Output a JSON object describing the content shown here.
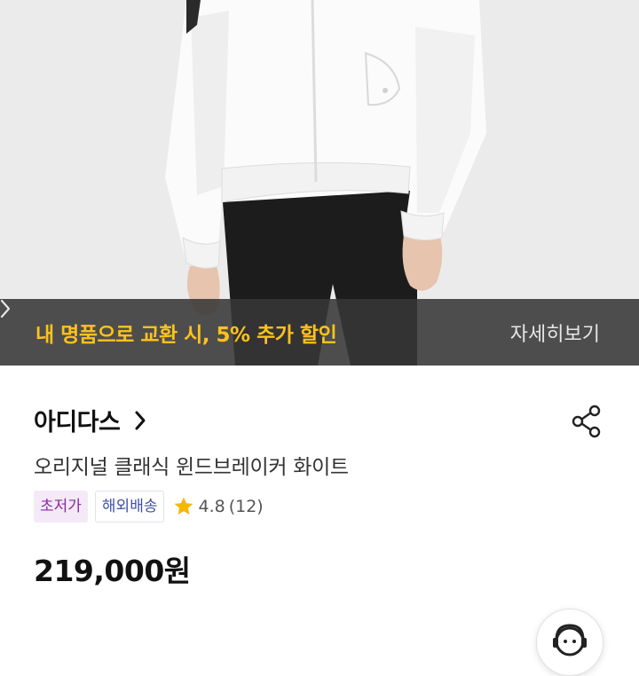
{
  "promo": {
    "text": "내 명품으로 교환 시, 5% 추가 할인",
    "link_label": "자세히보기"
  },
  "product": {
    "brand": "아디다스",
    "title": "오리지널 클래식 윈드브레이커 화이트",
    "tags": [
      "초저가",
      "해외배송"
    ],
    "rating": "4.8",
    "review_count": "(12)",
    "price": "219,000원"
  },
  "colors": {
    "promo_accent": "#ffc21a",
    "star": "#f5b800",
    "tag_low_text": "#8a2aa3",
    "tag_ship_text": "#3f4fa8"
  },
  "icons": {
    "share": "share-icon",
    "brand_arrow": "chevron-right-icon",
    "promo_arrow": "chevron-right-icon",
    "star": "star-icon",
    "chat": "chat-support-icon"
  }
}
